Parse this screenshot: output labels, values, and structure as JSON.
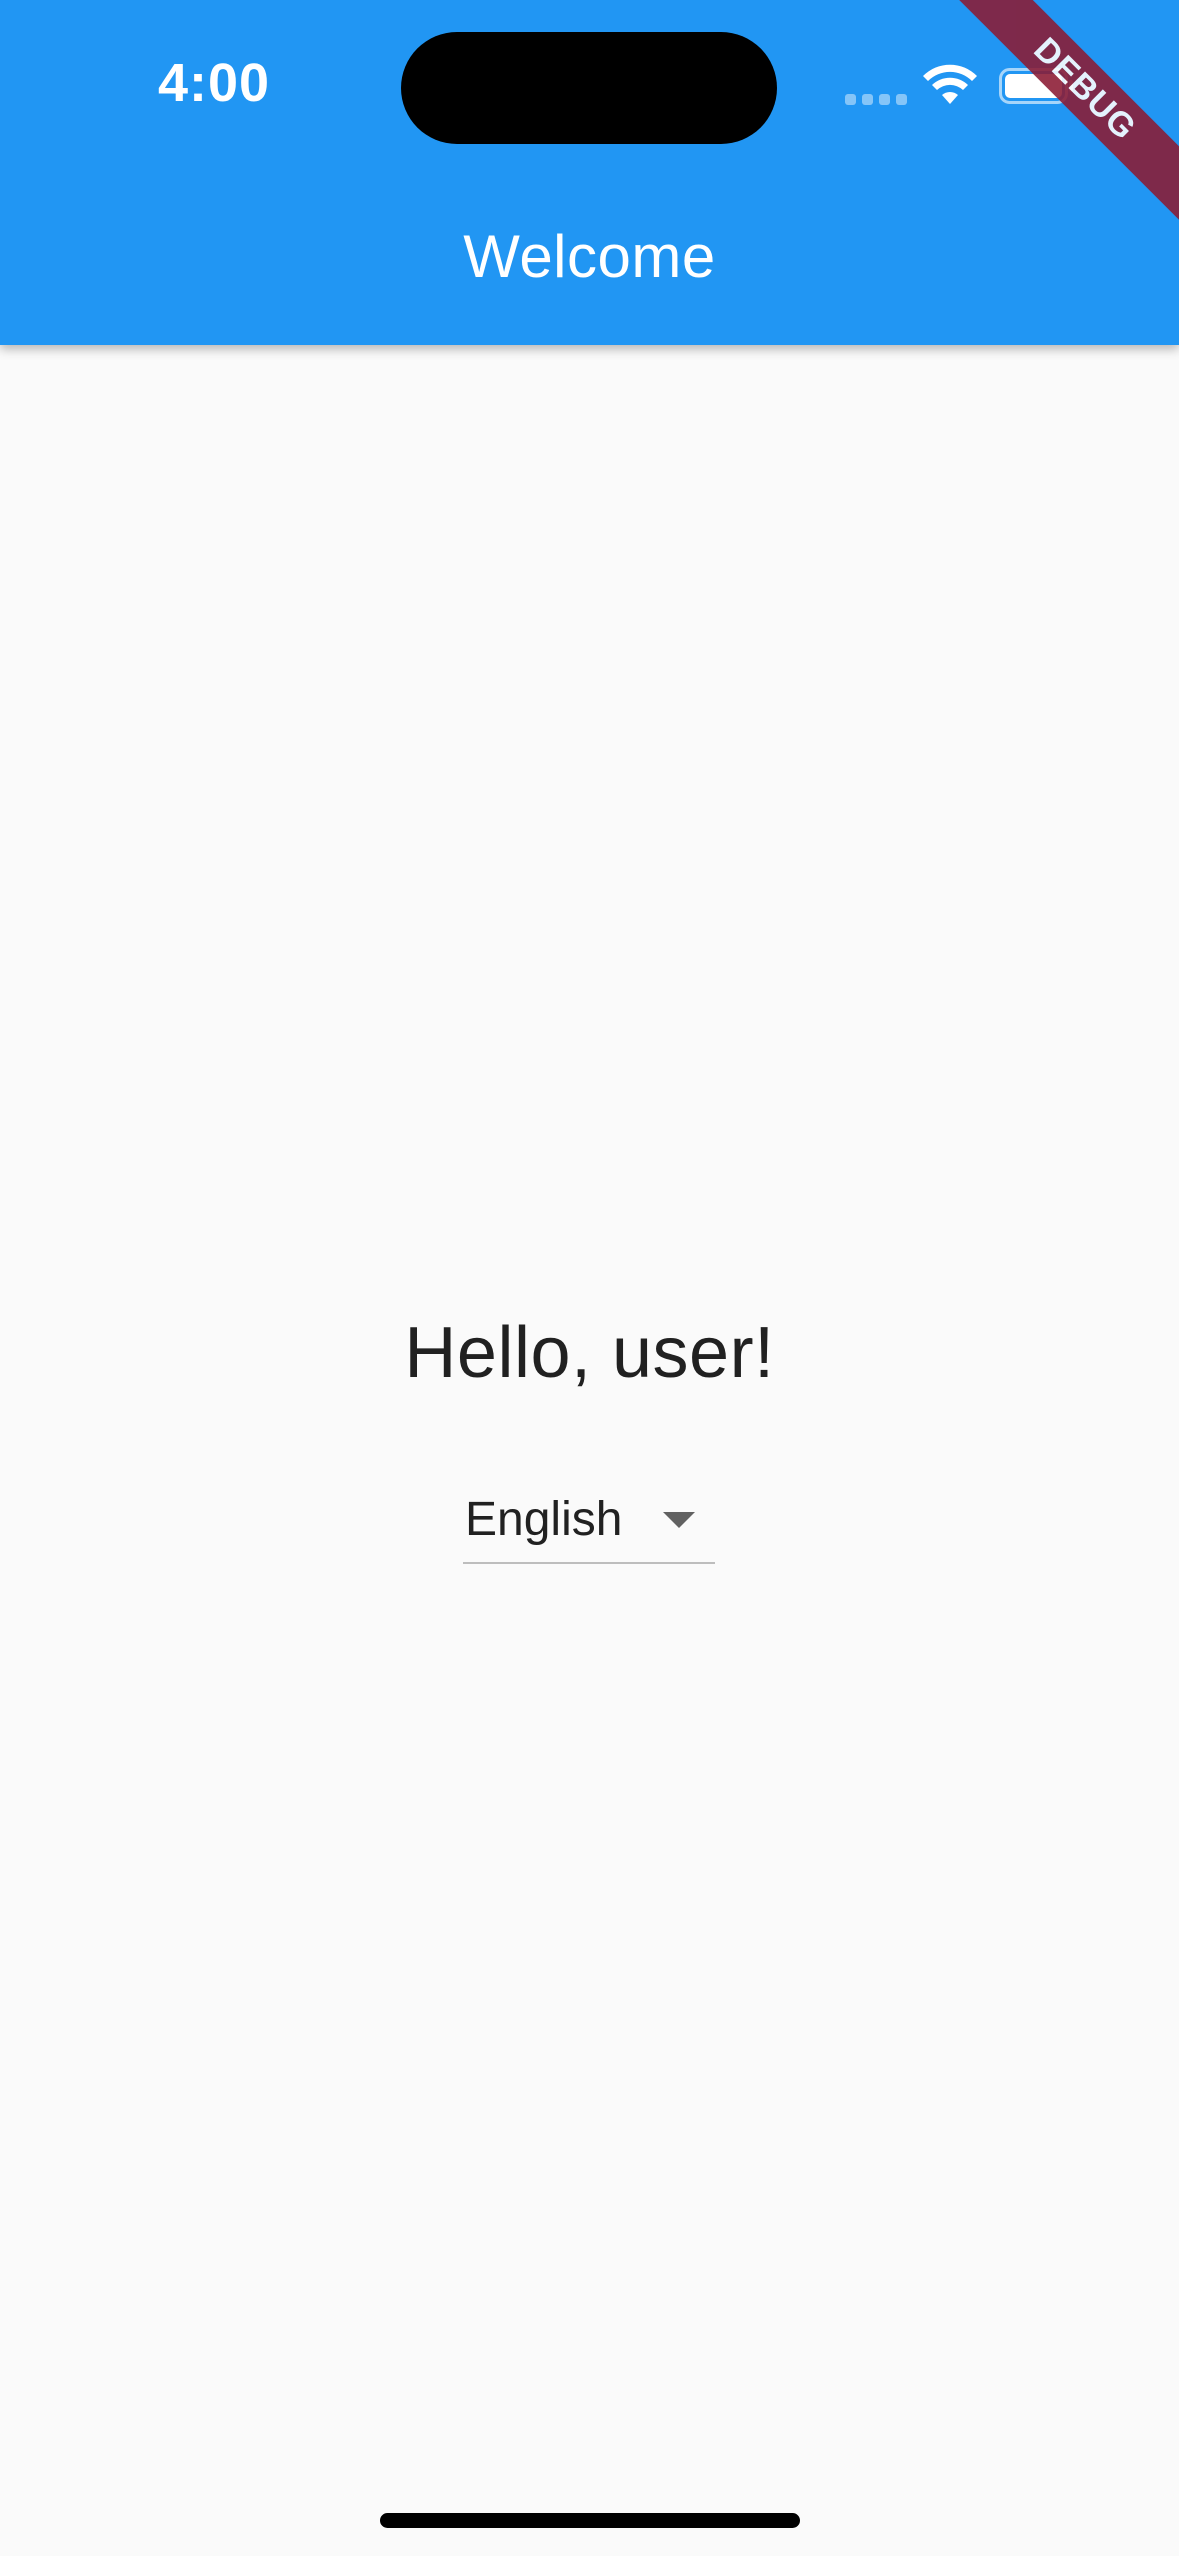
{
  "status_bar": {
    "time": "4:00"
  },
  "app_bar": {
    "title": "Welcome",
    "color": "#2196F3"
  },
  "debug_banner": {
    "label": "DEBUG"
  },
  "main": {
    "greeting": "Hello, user!",
    "language_dropdown": {
      "selected": "English"
    }
  },
  "icons": [
    "wifi-icon",
    "battery-icon",
    "cellular-signal-icon",
    "dropdown-arrow-icon"
  ]
}
